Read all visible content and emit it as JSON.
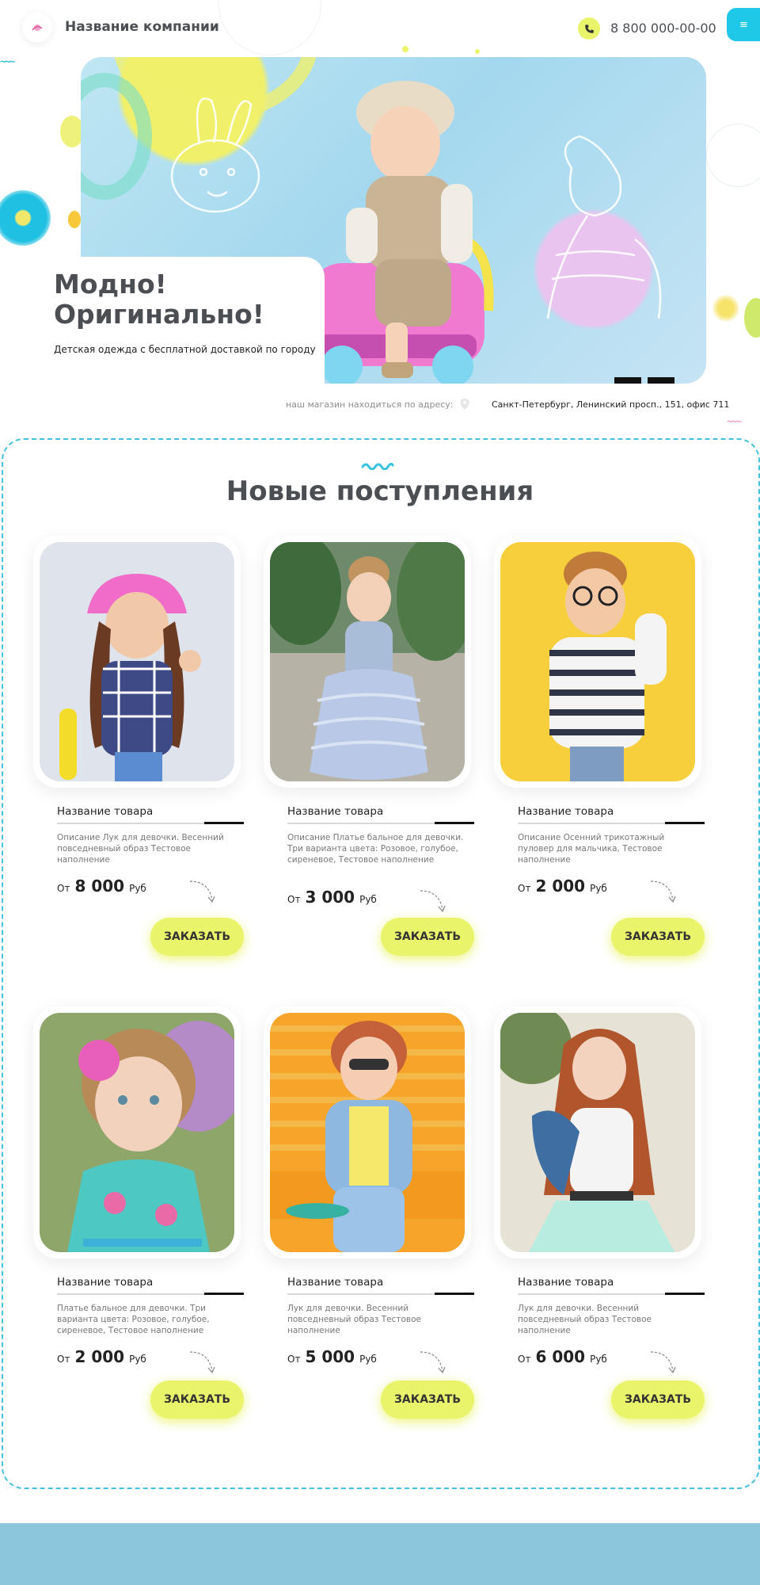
{
  "header": {
    "company_name": "Название компании",
    "phone": "8 800 000-00-00",
    "menu_icon": "≡",
    "icons": [
      "logo-icon",
      "phone-icon",
      "menu-icon"
    ]
  },
  "hero": {
    "title": "Модно! Оригинально!",
    "subtitle": "Детская одежда с бесплатной доставкой по городу",
    "slides": 2
  },
  "address": {
    "label": "наш магазин находиться по адресу:",
    "value": "Санкт-Петербург, Ленинский просп., 151, офис 711"
  },
  "section": {
    "title": "Новые поступления"
  },
  "products": [
    {
      "name": "Название товара",
      "description": "Описание Лук для девочки. Весенний повседневный образ Тестовое наполнение",
      "price_prefix": "От",
      "price": "8 000",
      "currency": "Руб",
      "button": "ЗАКАЗАТЬ"
    },
    {
      "name": "Название товара",
      "description": "Описание Платье бальное для девочки. Три варианта цвета: Розовое, голубое, сиреневое, Тестовое наполнение",
      "price_prefix": "От",
      "price": "3 000",
      "currency": "Руб",
      "button": "ЗАКАЗАТЬ"
    },
    {
      "name": "Название товара",
      "description": "Описание Осенний трикотажный пуловер для мальчика, Тестовое наполнение",
      "price_prefix": "От",
      "price": "2 000",
      "currency": "Руб",
      "button": "ЗАКАЗАТЬ"
    },
    {
      "name": "Название товара",
      "description": "Платье бальное для девочки. Три варианта цвета: Розовое, голубое, сиреневое, Тестовое наполнение",
      "price_prefix": "От",
      "price": "2 000",
      "currency": "Руб",
      "button": "ЗАКАЗАТЬ"
    },
    {
      "name": "Название товара",
      "description": "Лук для девочки. Весенний повседневный образ Тестовое наполнение",
      "price_prefix": "От",
      "price": "5 000",
      "currency": "Руб",
      "button": "ЗАКАЗАТЬ"
    },
    {
      "name": "Название товара",
      "description": "Лук для девочки. Весенний повседневный образ Тестовое наполнение",
      "price_prefix": "От",
      "price": "6 000",
      "currency": "Руб",
      "button": "ЗАКАЗАТЬ"
    }
  ],
  "colors": {
    "accent_cyan": "#1fc8e6",
    "accent_yellow": "#eaf46a",
    "text_dark": "#4b4f54",
    "footer_blue": "#8ac6dc"
  }
}
